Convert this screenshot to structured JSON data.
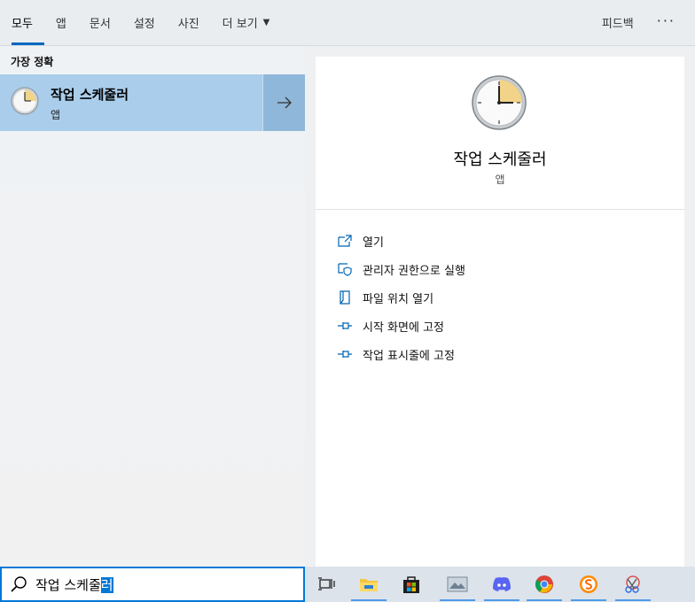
{
  "tabs": [
    {
      "label": "모두",
      "active": true
    },
    {
      "label": "앱"
    },
    {
      "label": "문서"
    },
    {
      "label": "설정"
    },
    {
      "label": "사진"
    },
    {
      "label": "더 보기"
    }
  ],
  "header": {
    "feedback_label": "피드백",
    "more_label": "···"
  },
  "results": {
    "section_title": "가장 정확",
    "best_match": {
      "name": "작업 스케줄러",
      "type": "앱"
    }
  },
  "detail": {
    "name": "작업 스케줄러",
    "type": "앱",
    "actions": [
      {
        "label": "열기",
        "icon": "open-icon"
      },
      {
        "label": "관리자 권한으로 실행",
        "icon": "shield-icon"
      },
      {
        "label": "파일 위치 열기",
        "icon": "file-location-icon"
      },
      {
        "label": "시작 화면에 고정",
        "icon": "pin-icon"
      },
      {
        "label": "작업 표시줄에 고정",
        "icon": "pin-icon"
      }
    ]
  },
  "search": {
    "typed": "작업 스케줄",
    "composing": "러"
  },
  "taskbar": {
    "items": [
      "task-view-icon",
      "file-explorer-icon",
      "store-icon",
      "photos-icon",
      "discord-icon",
      "chrome-icon",
      "sublime-icon",
      "snipping-tool-icon"
    ]
  },
  "colors": {
    "accent": "#0078d7",
    "selection": "#a9cdeb"
  }
}
